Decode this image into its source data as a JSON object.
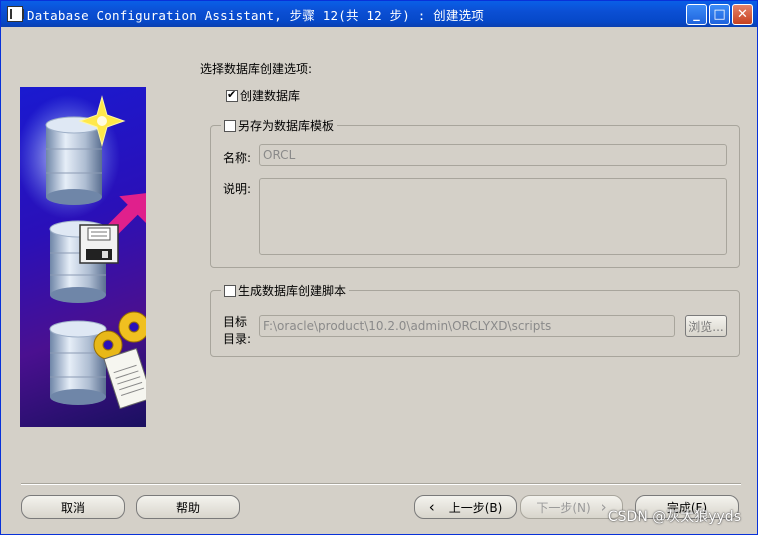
{
  "window": {
    "title": "Database Configuration Assistant, 步骤 12(共 12 步) : 创建选项"
  },
  "main": {
    "heading": "选择数据库创建选项:",
    "create_db_label": "创建数据库",
    "save_template_label": "另存为数据库模板",
    "name_label": "名称:",
    "name_value": "ORCL",
    "description_label": "说明:",
    "description_value": "",
    "gen_scripts_label": "生成数据库创建脚本",
    "target_label_line1": "目标",
    "target_label_line2": "目录:",
    "target_value": "F:\\oracle\\product\\10.2.0\\admin\\ORCLYXD\\scripts",
    "browse_label": "浏览..."
  },
  "footer": {
    "cancel_label": "取消",
    "help_label": "帮助",
    "back_label": "上一步(B)",
    "back_icon": "‹",
    "next_label": "下一步(N)",
    "next_icon": "›",
    "finish_label": "完成(F)"
  },
  "watermark": "CSDN @灰太狼yyds"
}
